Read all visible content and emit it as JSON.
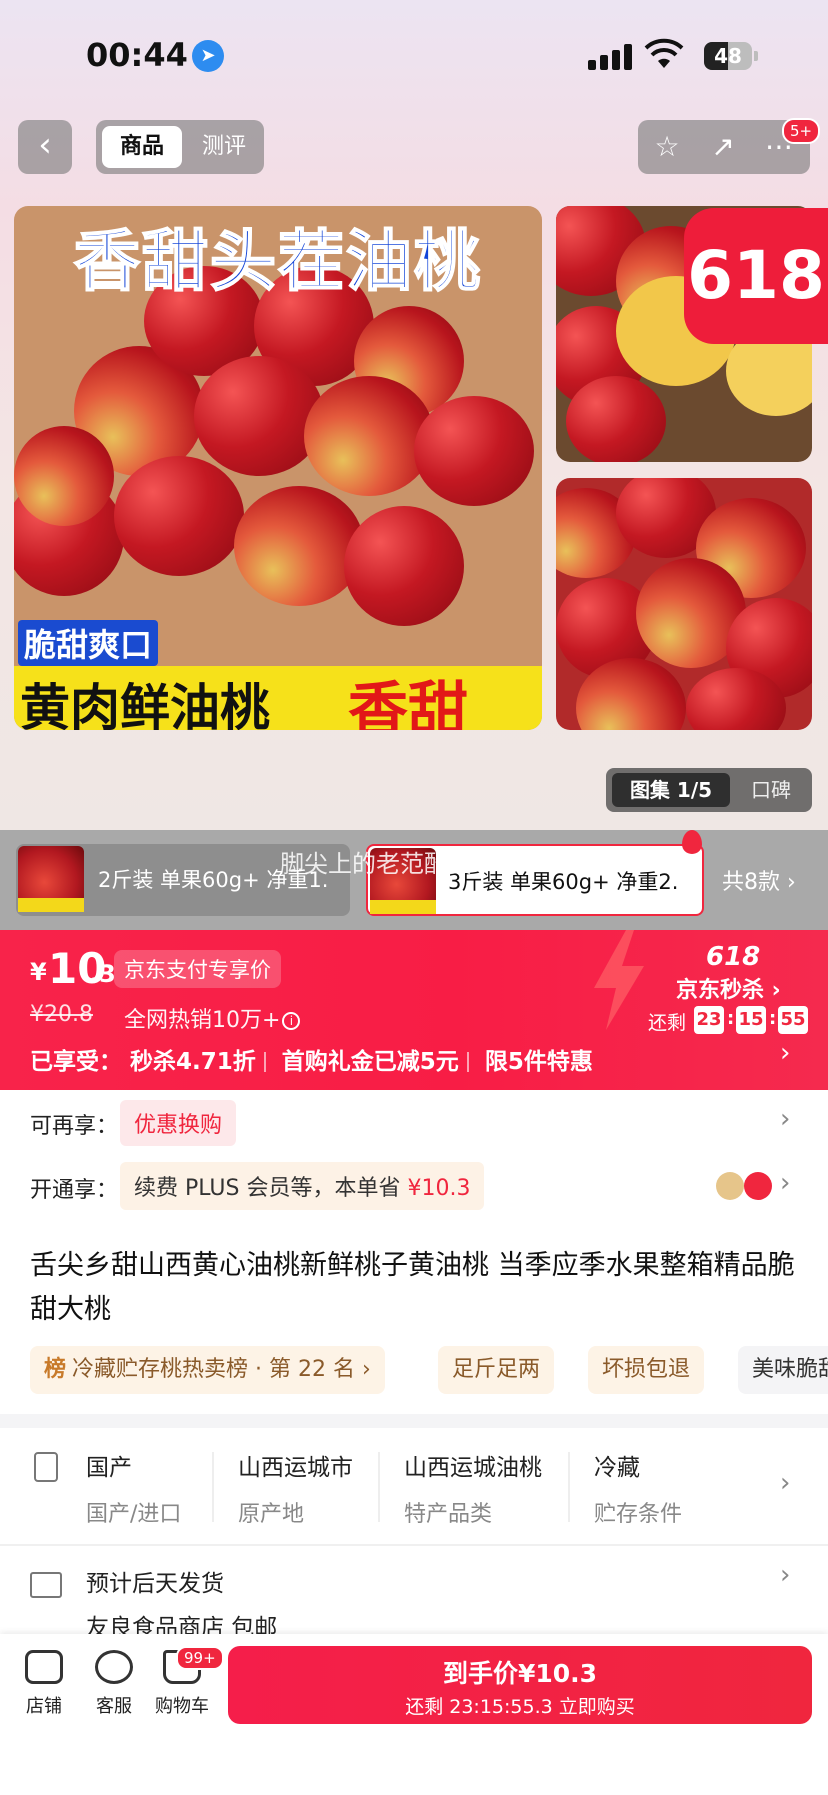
{
  "status": {
    "time": "00:44",
    "battery": "48"
  },
  "nav": {
    "back": "‹",
    "tab_product": "商品",
    "tab_review": "测评",
    "msg_badge": "5+"
  },
  "gallery": {
    "main_title": "香甜头茬油桃",
    "main_badge": "脆甜爽口",
    "main_bar_left": "黄肉鲜油桃",
    "main_bar_right": "香甜",
    "promo_badge": "618",
    "pill_album": "图集 1/5",
    "pill_reputation": "口碑"
  },
  "sku": {
    "items": [
      {
        "label": "2斤装 单果60g+ 净重1."
      },
      {
        "label": "3斤装 单果60g+ 净重2."
      }
    ],
    "total": "共8款 ›",
    "watermark": "脚尖上的老范酷赛"
  },
  "price": {
    "currency": "¥",
    "int": "10",
    "dec": ".3",
    "pay_tag": "京东支付专享价",
    "original": "¥20.8",
    "sales": "全网热销10万+",
    "enjoyed_label": "已享受：",
    "enjoyed_1": "秒杀4.71折",
    "enjoyed_2": "首购礼金已减5元",
    "enjoyed_3": "限5件特惠",
    "event": "618",
    "seckill": "京东秒杀 ›",
    "remain_label": "还剩",
    "h": "23",
    "m": "15",
    "s": "55"
  },
  "offers": {
    "more_label": "可再享：",
    "more_tag": "优惠换购",
    "open_label": "开通享：",
    "open_tag": "续费 PLUS 会员等，本单省 ",
    "open_save": "¥10.3"
  },
  "product": {
    "title": "舌尖乡甜山西黄心油桃新鲜桃子黄油桃 当季应季水果整箱精品脆甜大桃",
    "rank_icon": "榜",
    "rank": "冷藏贮存桃热卖榜 · 第 22 名 ›",
    "tags": [
      "足斤足两",
      "坏损包退",
      "美味脆甜"
    ]
  },
  "attrs": [
    {
      "value": "国产",
      "key": "国产/进口"
    },
    {
      "value": "山西运城市",
      "key": "原产地"
    },
    {
      "value": "山西运城油桃",
      "key": "特产品类"
    },
    {
      "value": "冷藏",
      "key": "贮存条件"
    }
  ],
  "shipping": {
    "line1": "预计后天发货",
    "line2": "友良食品商店  包邮"
  },
  "bottom": {
    "store": "店铺",
    "service": "客服",
    "cart": "购物车",
    "cart_badge": "99+",
    "buy_l1": "到手价¥10.3",
    "buy_l2": "还剩 23:15:55.3 立即购买"
  },
  "colors": {
    "accent": "#f0263e",
    "promo_yellow": "#f6e11a",
    "title_blue": "#1244d8"
  }
}
